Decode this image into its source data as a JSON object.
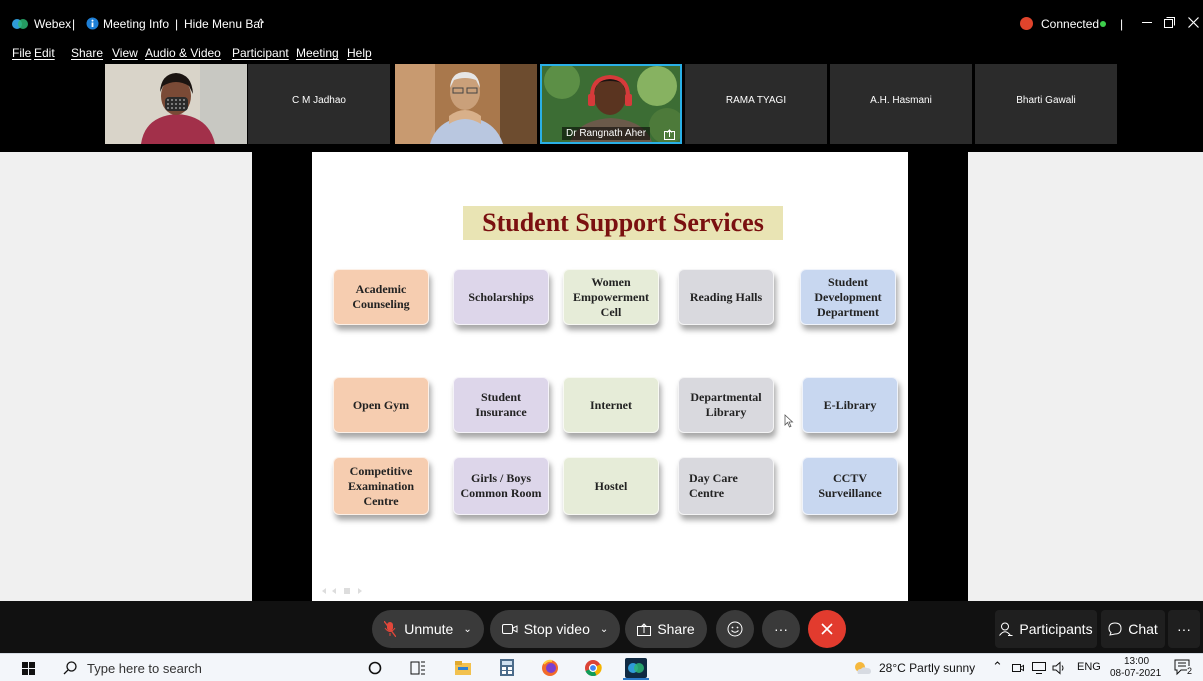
{
  "titlebar": {
    "app_name": "Webex",
    "sep1": "|",
    "meeting_info": "Meeting Info",
    "sep2": "|",
    "hide_menu_bar": "Hide Menu Bar",
    "chevron": "^",
    "connected": "Connected",
    "sep3": "|"
  },
  "menu": [
    "File",
    "Edit",
    "Share",
    "View",
    "Audio & Video",
    "Participant",
    "Meeting",
    "Help"
  ],
  "participants_strip": {
    "tiles": [
      {
        "name": "",
        "has_video": true
      },
      {
        "name": "C M Jadhao",
        "has_video": false
      },
      {
        "name": "",
        "has_video": true
      },
      {
        "name": "Dr Rangnath Aher",
        "has_video": true,
        "active_speaker": true
      },
      {
        "name": "RAMA TYAGI",
        "has_video": false
      },
      {
        "name": "A.H. Hasmani",
        "has_video": false
      },
      {
        "name": "Bharti Gawali",
        "has_video": false
      }
    ]
  },
  "slide": {
    "title": "Student  Support  Services",
    "boxes": [
      {
        "label": "Academic Counseling",
        "color": "#f6cdb0"
      },
      {
        "label": "Scholarships",
        "color": "#ddd6ea"
      },
      {
        "label": "Women Empowerment Cell",
        "color": "#e6ecd8"
      },
      {
        "label": "Reading Halls",
        "color": "#d9d9de"
      },
      {
        "label": "Student Development Department",
        "color": "#c8d7f0"
      },
      {
        "label": "Open Gym",
        "color": "#f6cdb0"
      },
      {
        "label": "Student Insurance",
        "color": "#ddd6ea"
      },
      {
        "label": "Internet",
        "color": "#e6ecd8"
      },
      {
        "label": "Departmental Library",
        "color": "#d9d9de"
      },
      {
        "label": "E-Library",
        "color": "#c8d7f0"
      },
      {
        "label": "Competitive Examination Centre",
        "color": "#f6cdb0"
      },
      {
        "label": "Girls / Boys Common Room",
        "color": "#ddd6ea"
      },
      {
        "label": "Hostel",
        "color": "#e6ecd8"
      },
      {
        "label": "Day Care Centre",
        "color": "#d9d9de"
      },
      {
        "label": "CCTV Surveillance",
        "color": "#c8d7f0"
      }
    ]
  },
  "controls": {
    "unmute": "Unmute",
    "stop_video": "Stop video",
    "share": "Share",
    "more": "···",
    "participants": "Participants",
    "chat": "Chat",
    "overflow": "···"
  },
  "taskbar": {
    "search_placeholder": "Type here to search",
    "weather": "28°C  Partly sunny",
    "lang": "ENG",
    "time": "13:00",
    "date": "08-07-2021",
    "notif_count": "2"
  },
  "colors": {
    "end_button": "#e23b2e",
    "connected_dot": "#3ecf4c",
    "record_dot": "#e0442c",
    "speaker_border": "#2ab0e6",
    "title_text": "#7a1010",
    "title_bg": "#e9e4b4"
  }
}
